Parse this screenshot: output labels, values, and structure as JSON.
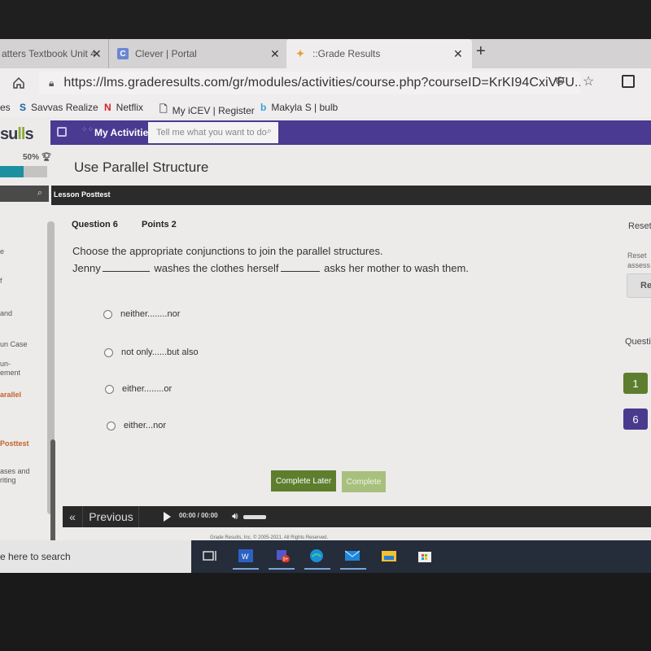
{
  "browser": {
    "tabs": [
      {
        "label": "atters Textbook Unit 4",
        "close": "✕"
      },
      {
        "label": "Clever | Portal",
        "icon": "C",
        "close": "✕"
      },
      {
        "label": "::Grade Results",
        "close": "✕",
        "active": true
      }
    ],
    "new_tab": "+",
    "url": "https://lms.graderesults.com/gr/modules/activities/course.php?courseID=KrKI94CxiVFU...",
    "bookmarks": [
      {
        "label": "es",
        "icon": ""
      },
      {
        "label": "Savvas Realize",
        "icon": "S"
      },
      {
        "label": "Netflix",
        "icon": "N"
      },
      {
        "label": "My iCEV | Register",
        "icon": "doc"
      },
      {
        "label": "Makyla S | bulb",
        "icon": "b"
      }
    ]
  },
  "app": {
    "logo": {
      "pre": "su",
      "mid": "ll",
      "post": "s"
    },
    "nav": {
      "my_activities": "My Activities",
      "search_placeholder": "Tell me what you want to do"
    },
    "progress": {
      "label": "50%",
      "value_percent": 50
    },
    "page_title": "Use Parallel Structure",
    "section_label": "Lesson Posttest",
    "sidebar": [
      {
        "label": "e",
        "active": false
      },
      {
        "label": "f",
        "active": false
      },
      {
        "label": "and",
        "active": false
      },
      {
        "label": "un Case",
        "active": false
      },
      {
        "label": "un-\nement",
        "active": false
      },
      {
        "label": "arallel",
        "active": true
      },
      {
        "label": "Posttest",
        "active": true
      },
      {
        "label": "ases and\nriting",
        "active": false
      }
    ],
    "question": {
      "number_label": "Question 6",
      "points_label": "Points 2",
      "prompt": "Choose the appropriate conjunctions to join the parallel structures.",
      "sentence_parts": [
        "Jenny",
        "washes the clothes herself",
        "asks her mother to wash them."
      ],
      "options": [
        "neither........nor",
        "not only......but also",
        "either........or",
        "either...nor"
      ],
      "selected": null
    },
    "right_panel": {
      "reset_heading": "Reset",
      "reset_desc_line1": "Reset",
      "reset_desc_line2": "assess",
      "reset_button": "Re",
      "questions_heading": "Questi",
      "question_buttons": [
        {
          "label": "1",
          "color": "#5d7e2f"
        },
        {
          "label": "6",
          "color": "#4a3a8e"
        }
      ]
    },
    "buttons": {
      "complete_later": "Complete Later",
      "complete": "Complete"
    },
    "footer_nav": {
      "prev_icon": "«",
      "previous": "Previous",
      "time": "00:00 / 00:00"
    },
    "copyright": "Grade Results, Inc. © 2005-2021. All Rights Reserved."
  },
  "taskbar": {
    "search_text": "e here to search",
    "apps": [
      "task-view",
      "word",
      "teams",
      "edge",
      "mail",
      "file-explorer",
      "store"
    ],
    "teams_badge": "9+"
  },
  "colors": {
    "purple": "#4b3a91",
    "green": "#5e7e2e",
    "green_light": "#a8c07d",
    "teal": "#1d90a0",
    "accent_orange": "#c2622a"
  }
}
